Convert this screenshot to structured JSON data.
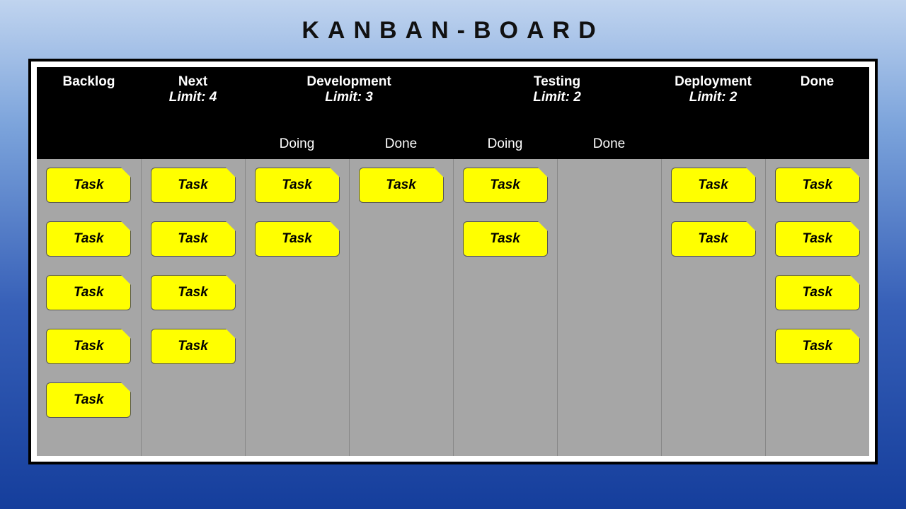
{
  "title": "KANBAN-BOARD",
  "card_label": "Task",
  "columns": {
    "backlog": {
      "name": "Backlog",
      "limit": null,
      "sub": null
    },
    "next": {
      "name": "Next",
      "limit": "Limit: 4",
      "sub": null
    },
    "development": {
      "name": "Development",
      "limit": "Limit: 3",
      "sub": [
        "Doing",
        "Done"
      ]
    },
    "testing": {
      "name": "Testing",
      "limit": "Limit: 2",
      "sub": [
        "Doing",
        "Done"
      ]
    },
    "deployment": {
      "name": "Deployment",
      "limit": "Limit: 2",
      "sub": null
    },
    "done": {
      "name": "Done",
      "limit": null,
      "sub": null
    }
  },
  "lanes": {
    "backlog": 5,
    "next": 4,
    "dev_doing": 2,
    "dev_done": 1,
    "test_doing": 2,
    "test_done": 0,
    "deployment": 2,
    "done": 4
  }
}
